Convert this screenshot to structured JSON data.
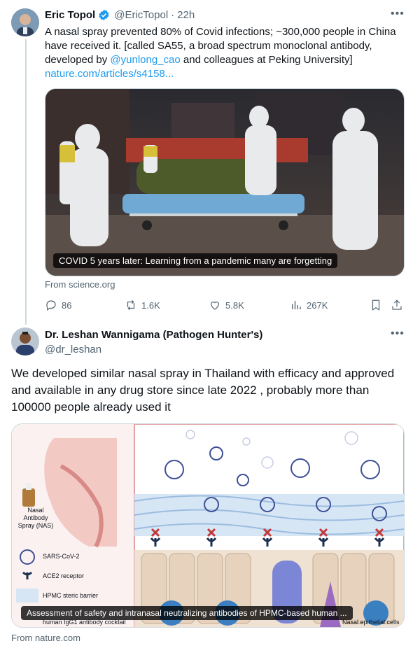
{
  "tweet1": {
    "name": "Eric Topol",
    "handle": "@EricTopol",
    "sep": "·",
    "time": "22h",
    "text_1": "A nasal spray prevented 80% of Covid infections; ~300,000 people in China have received it. [called SA55, a broad spectrum monoclonal antibody, developed by ",
    "mention": "@yunlong_cao",
    "text_2": " and colleagues at Peking University]",
    "link": "nature.com/articles/s4158...",
    "card_caption": "COVID 5 years later: Learning from a pandemic many are forgetting",
    "card_source": "From science.org",
    "stats": {
      "replies": "86",
      "reposts": "1.6K",
      "likes": "5.8K",
      "views": "267K"
    }
  },
  "tweet2": {
    "name": "Dr. Leshan Wannigama (Pathogen Hunter's)",
    "handle": "@dr_leshan",
    "text": "We developed similar nasal spray in Thailand with efficacy and approved and available in any drug store since late 2022 , probably more than 100000 people already used it",
    "card_caption": "Assessment of safety and intranasal neutralizing antibodies of HPMC-based human ...",
    "card_source": "From nature.com",
    "figure": {
      "nas_label": "Nasal Antibody Spray (NAS)",
      "legend_virus": "SARS-CoV-2",
      "legend_ace2": "ACE2 receptor",
      "legend_hpmc": "HPMC steric barrier",
      "legend_igg": "human IgG1 antibody cocktail",
      "cells_label": "Nasal epithelial cells"
    }
  },
  "colors": {
    "accent": "#1d9bf0",
    "muted": "#536471",
    "divider": "#cfd9de"
  },
  "icons": [
    "more-icon",
    "verified-badge-icon",
    "reply-icon",
    "repost-icon",
    "like-icon",
    "views-icon",
    "bookmark-icon",
    "share-icon"
  ]
}
